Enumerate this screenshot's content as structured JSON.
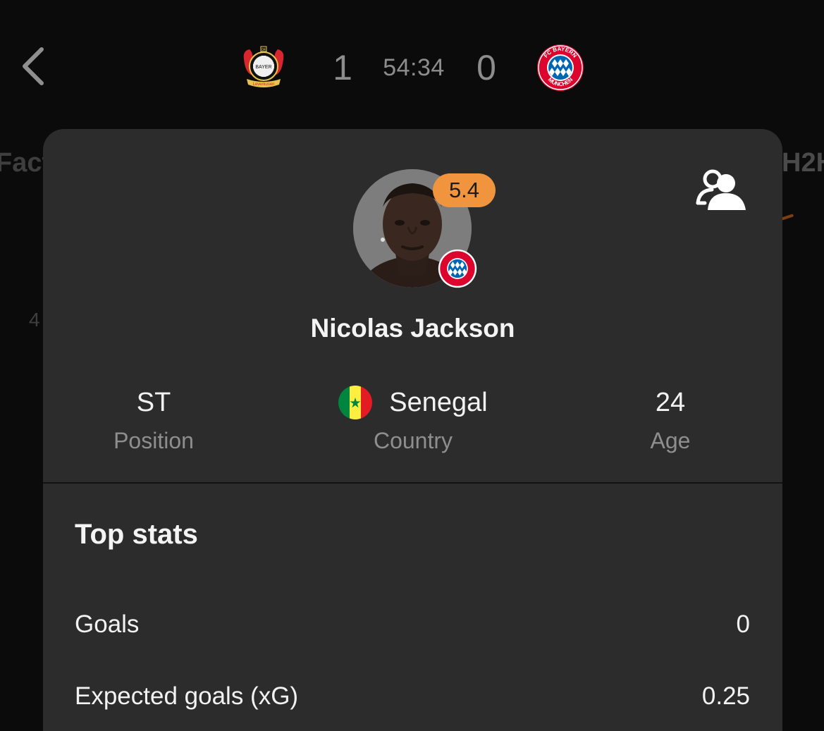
{
  "header": {
    "home_score": "1",
    "clock": "54:34",
    "away_score": "0",
    "home_team_logo": "leverkusen-crest",
    "home_team_logo_text": [
      "BAYER",
      "04",
      "Leverkusen"
    ],
    "away_team_logo": "bayern-munich-crest",
    "away_team_logo_text": [
      "FC BAYERN",
      "MÜNCHEN"
    ]
  },
  "background_tabs": {
    "left_partial": "Fact",
    "right_partial": "H2H",
    "left_number": "4"
  },
  "player": {
    "name": "Nicolas Jackson",
    "rating": "5.4",
    "rating_color": "#f0953e",
    "position_value": "ST",
    "position_label": "Position",
    "country_value": "Senegal",
    "country_label": "Country",
    "age_value": "24",
    "age_label": "Age"
  },
  "top_stats": {
    "title": "Top stats",
    "rows": [
      {
        "label": "Goals",
        "value": "0"
      },
      {
        "label": "Expected goals (xG)",
        "value": "0.25"
      }
    ]
  },
  "icons": {
    "back": "chevron-left-icon",
    "profile": "profile-icon"
  },
  "colors": {
    "background": "#0b0b0b",
    "sheet": "#2c2c2c",
    "text_primary": "#f2f2f2",
    "text_secondary": "#8e8e8e"
  }
}
